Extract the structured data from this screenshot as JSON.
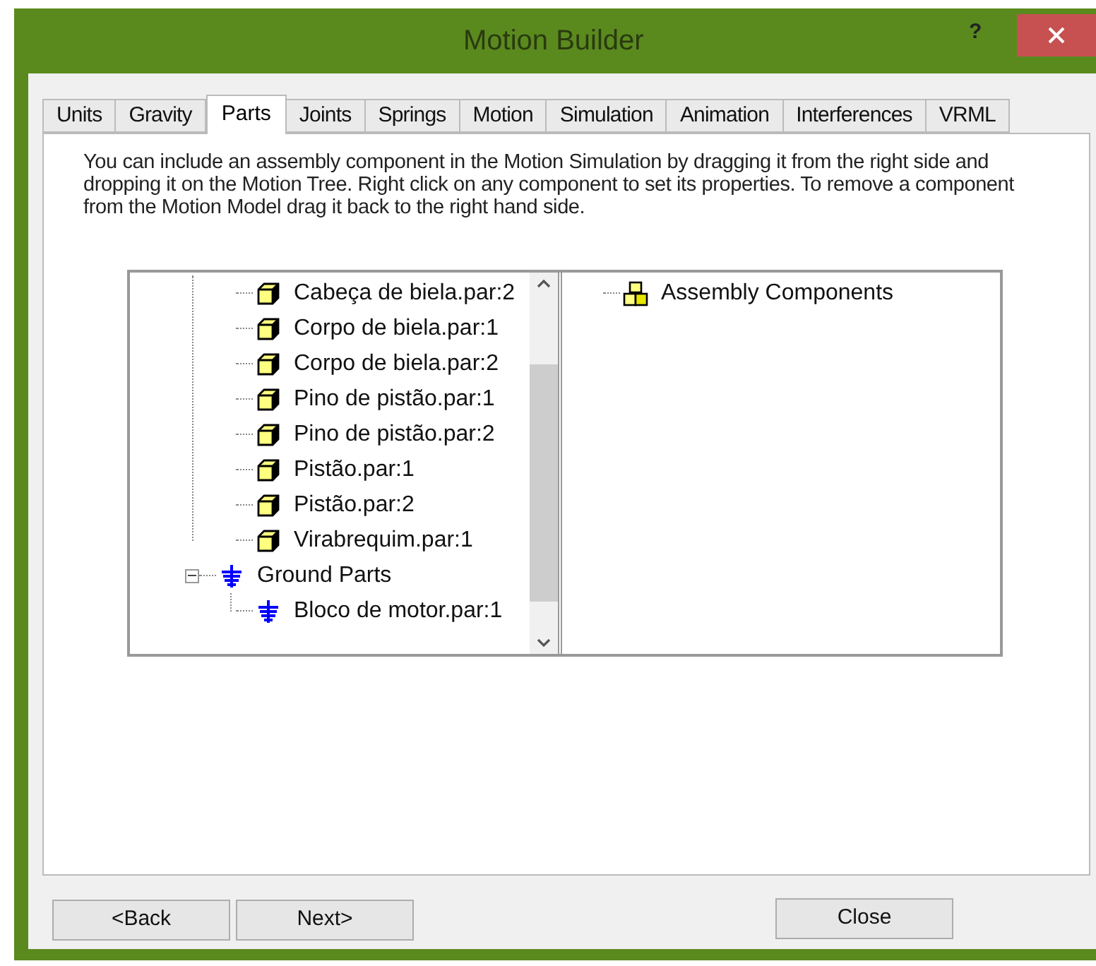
{
  "window": {
    "title": "Motion Builder",
    "help": "?"
  },
  "tabs": [
    {
      "label": "Units",
      "selected": false
    },
    {
      "label": "Gravity",
      "selected": false
    },
    {
      "label": "Parts",
      "selected": true
    },
    {
      "label": "Joints",
      "selected": false
    },
    {
      "label": "Springs",
      "selected": false
    },
    {
      "label": "Motion",
      "selected": false
    },
    {
      "label": "Simulation",
      "selected": false
    },
    {
      "label": "Animation",
      "selected": false
    },
    {
      "label": "Interferences",
      "selected": false
    },
    {
      "label": "VRML",
      "selected": false
    }
  ],
  "instructions": "You can include an assembly component in the Motion Simulation by dragging it from the right side and dropping it on the Motion Tree. Right click on any component to set its properties. To remove a component from the Motion Model drag it back to the right hand side.",
  "motion_tree": [
    {
      "kind": "hidden",
      "children": [
        {
          "kind": "part",
          "label": "Cabeça de biela.par:2"
        },
        {
          "kind": "part",
          "label": "Corpo de biela.par:1"
        },
        {
          "kind": "part",
          "label": "Corpo de biela.par:2"
        },
        {
          "kind": "part",
          "label": "Pino de pistão.par:1"
        },
        {
          "kind": "part",
          "label": "Pino de pistão.par:2"
        },
        {
          "kind": "part",
          "label": "Pistão.par:1"
        },
        {
          "kind": "part",
          "label": "Pistão.par:2"
        },
        {
          "kind": "part",
          "label": "Virabrequim.par:1"
        }
      ]
    },
    {
      "kind": "ground",
      "label": "Ground Parts",
      "expanded": true,
      "children": [
        {
          "kind": "ground",
          "label": "Bloco de motor.par:1"
        }
      ]
    }
  ],
  "assembly_tree": [
    {
      "kind": "assembly",
      "label": "Assembly Components"
    }
  ],
  "buttons": [
    {
      "label": "<Back"
    },
    {
      "label": "Next>"
    }
  ],
  "close_button": "Close"
}
